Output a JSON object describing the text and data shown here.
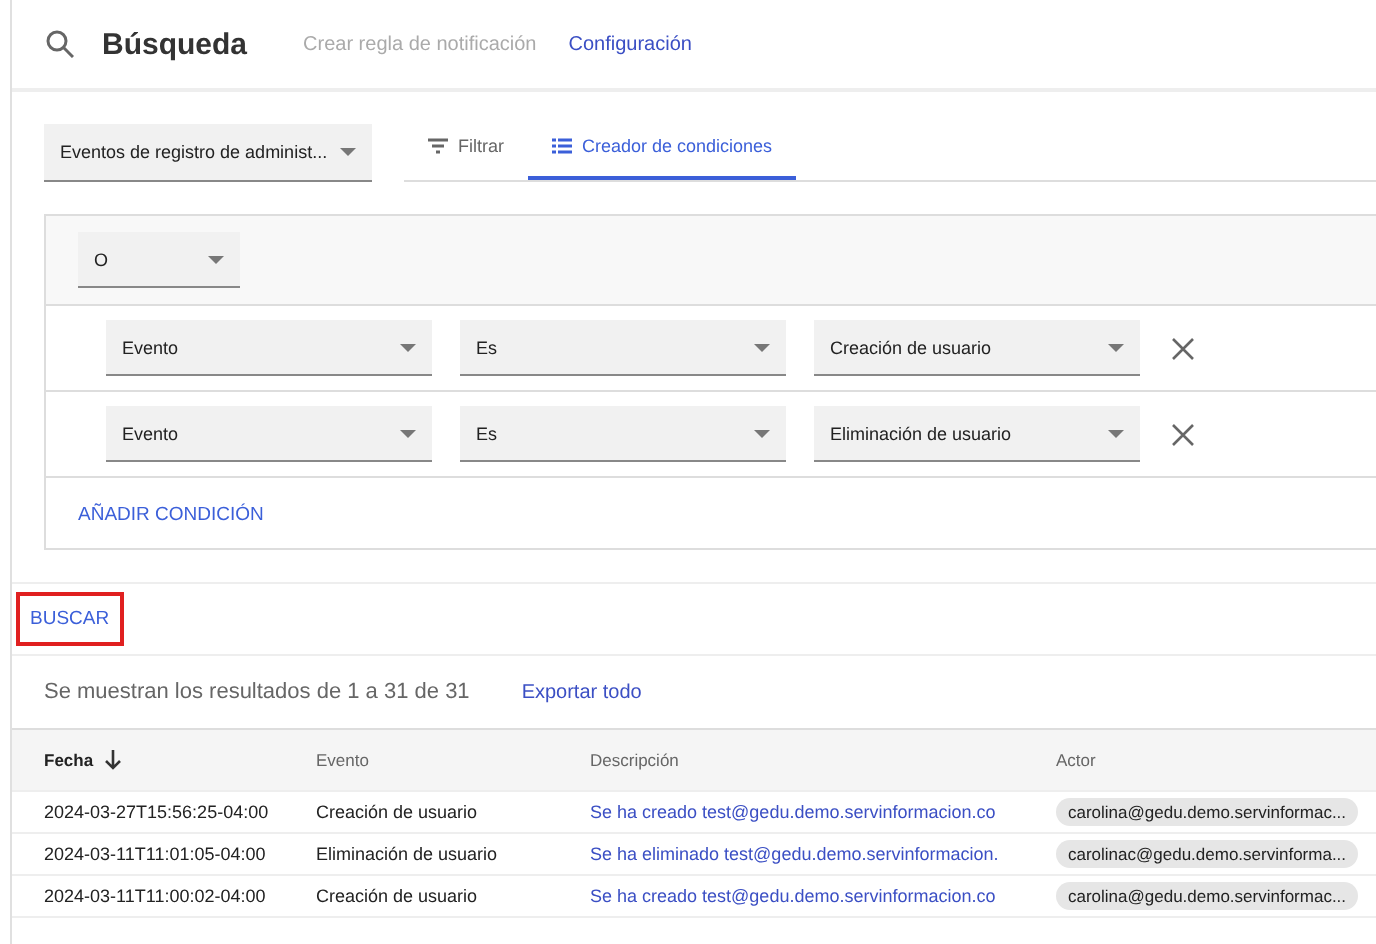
{
  "header": {
    "title": "Búsqueda",
    "links": [
      {
        "label": "Crear regla de notificación",
        "disabled": true
      },
      {
        "label": "Configuración",
        "disabled": false
      }
    ]
  },
  "source_select": {
    "value": "Eventos de registro de administ..."
  },
  "tabs": [
    {
      "label": "Filtrar",
      "kind": "filter",
      "selected": false
    },
    {
      "label": "Creador de condiciones",
      "kind": "builder",
      "selected": true
    }
  ],
  "operator_select": {
    "value": "O"
  },
  "conditions": [
    {
      "field": "Evento",
      "operator": "Es",
      "value": "Creación de usuario"
    },
    {
      "field": "Evento",
      "operator": "Es",
      "value": "Eliminación de usuario"
    }
  ],
  "add_condition": "AÑADIR CONDICIÓN",
  "search_button": {
    "label": "BUSCAR",
    "highlighted": true
  },
  "results": {
    "summary": "Se muestran los resultados de 1 a 31 de 31",
    "export": "Exportar todo"
  },
  "table": {
    "columns": [
      {
        "label": "Fecha",
        "sorted": true
      },
      {
        "label": "Evento",
        "sorted": false
      },
      {
        "label": "Descripción",
        "sorted": false
      },
      {
        "label": "Actor",
        "sorted": false
      }
    ],
    "rows": [
      [
        "2024-03-27T15:56:25-04:00",
        "Creación de usuario",
        "Se ha creado test@gedu.demo.servinformacion.co",
        "carolina@gedu.demo.servinformac..."
      ],
      [
        "2024-03-11T11:01:05-04:00",
        "Eliminación de usuario",
        "Se ha eliminado test@gedu.demo.servinformacion.",
        "carolinac@gedu.demo.servinforma..."
      ],
      [
        "2024-03-11T11:00:02-04:00",
        "Creación de usuario",
        "Se ha creado test@gedu.demo.servinformacion.co",
        "carolina@gedu.demo.servinformac..."
      ]
    ]
  }
}
